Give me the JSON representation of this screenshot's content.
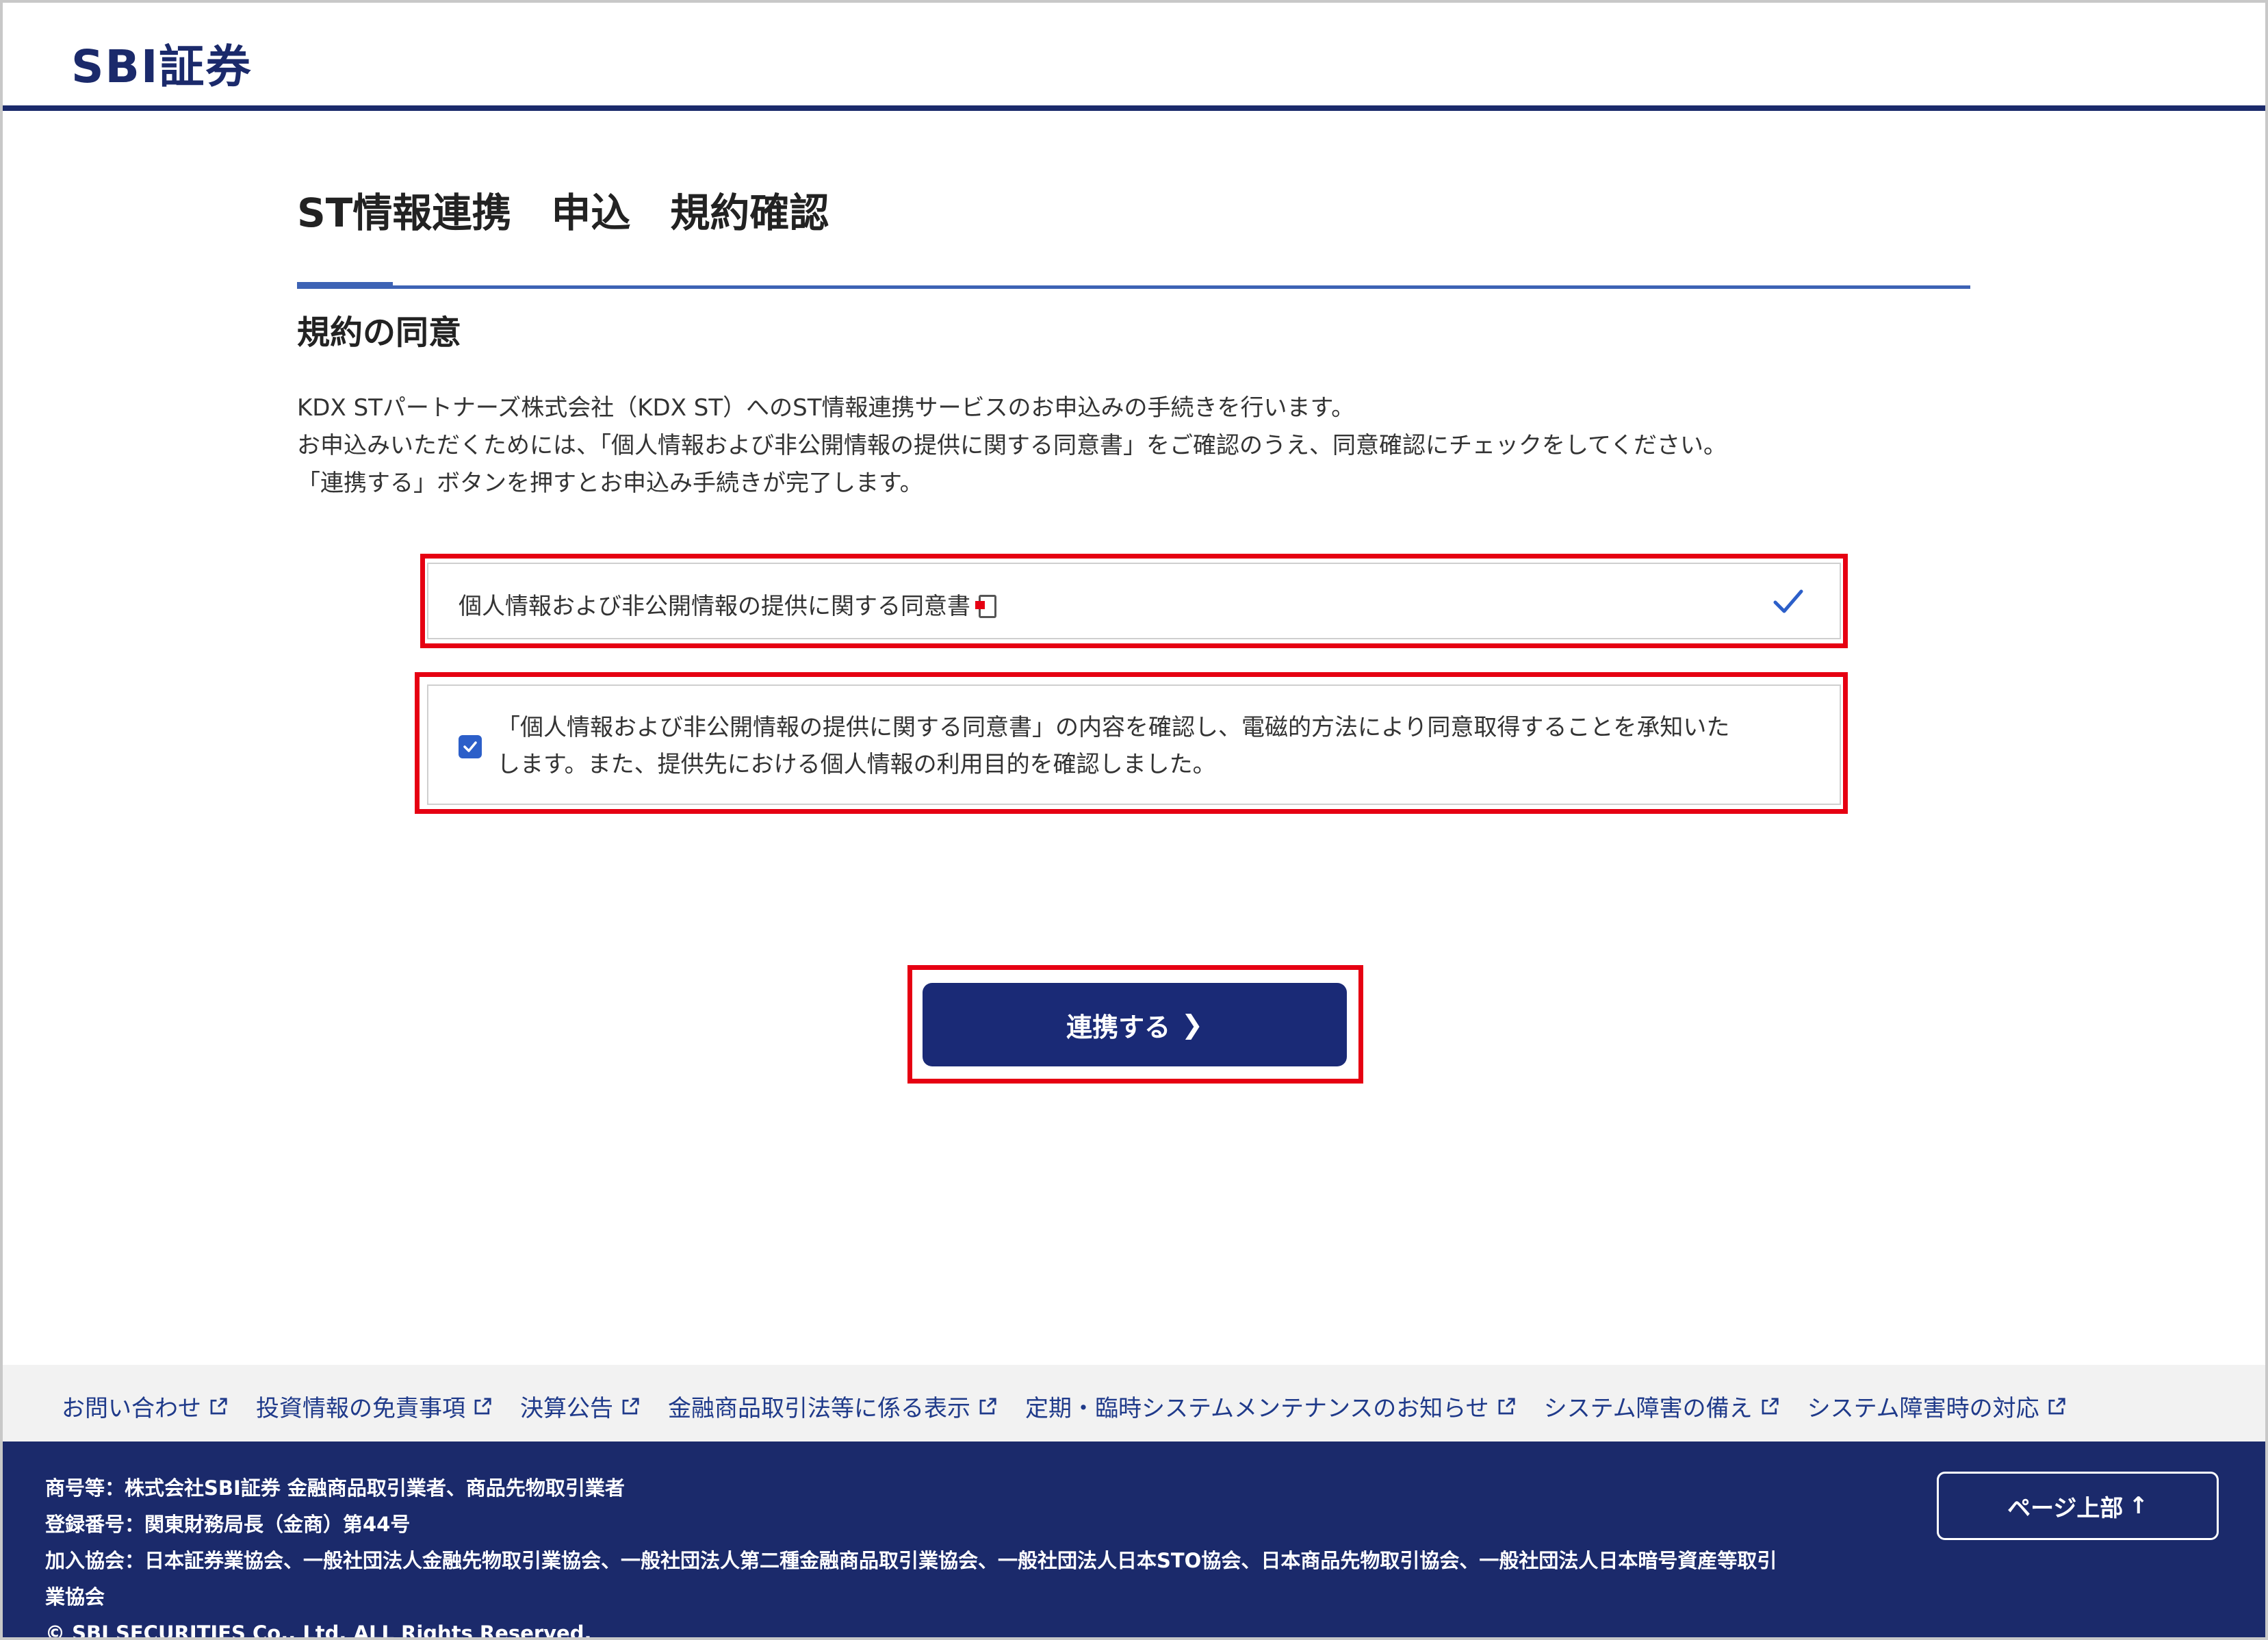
{
  "header": {
    "logo": "SBI証券"
  },
  "page": {
    "title": "ST情報連携　申込　規約確認",
    "section_title": "規約の同意",
    "intro": [
      "KDX STパートナーズ株式会社（KDX ST）へのST情報連携サービスのお申込みの手続きを行います。",
      "お申込みいただくためには、「個人情報および非公開情報の提供に関する同意書」をご確認のうえ、同意確認にチェックをしてください。",
      "「連携する」ボタンを押すとお申込み手続きが完了します。"
    ]
  },
  "document": {
    "label": "個人情報および非公開情報の提供に関する同意書",
    "viewed": true
  },
  "agreement": {
    "checked": true,
    "lines": [
      "「個人情報および非公開情報の提供に関する同意書」の内容を確認し、電磁的方法により同意取得することを承知いた",
      "します。また、提供先における個人情報の利用目的を確認しました。"
    ]
  },
  "submit": {
    "label": "連携する"
  },
  "footer_links": [
    "お問い合わせ",
    "投資情報の免責事項",
    "決算公告",
    "金融商品取引法等に係る表示",
    "定期・臨時システムメンテナンスのお知らせ",
    "システム障害の備え",
    "システム障害時の対応"
  ],
  "footer": {
    "lines": [
      "商号等：株式会社SBI証券 金融商品取引業者、商品先物取引業者",
      "登録番号：関東財務局長（金商）第44号",
      "加入協会：日本証券業協会、一般社団法人金融先物取引業協会、一般社団法人第二種金融商品取引業協会、一般社団法人日本STO協会、日本商品先物取引協会、一般社団法人日本暗号資産等取引",
      "業協会",
      "© SBI SECURITIES Co., Ltd. ALL Rights Reserved."
    ],
    "page_top_label": "ページ上部"
  },
  "colors": {
    "brand_navy": "#1b2a6b",
    "button_navy": "#1a2a76",
    "highlight_red": "#e60012",
    "accent_blue": "#3d63b5",
    "link_blue": "#1f3a8a"
  }
}
